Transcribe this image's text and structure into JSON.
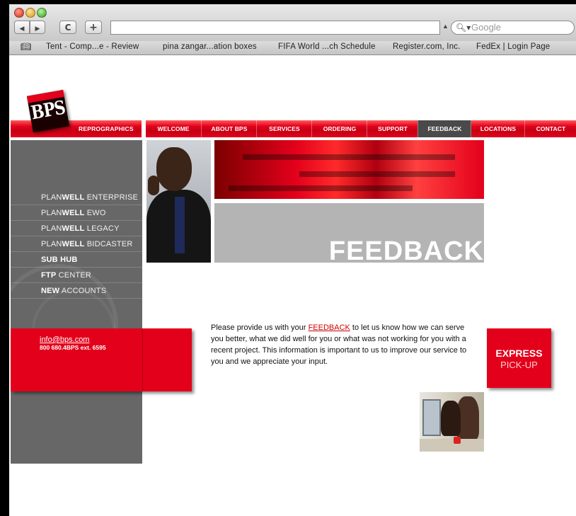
{
  "browser": {
    "back_glyph": "◀",
    "forward_glyph": "▶",
    "reload_glyph": "C",
    "add_glyph": "+",
    "url": "",
    "search_placeholder": "Google",
    "bookmarks": [
      "Tent - Comp...e - Review",
      "pina zangar...ation boxes",
      "FIFA World ...ch Schedule",
      "Register.com, Inc.",
      "FedEx | Login Page"
    ]
  },
  "site": {
    "logo_text": "BPS",
    "tagline": "REPROGRAPHICS",
    "nav": [
      "WELCOME",
      "ABOUT BPS",
      "SERVICES",
      "ORDERING",
      "SUPPORT",
      "FEEDBACK",
      "LOCATIONS",
      "CONTACT"
    ],
    "active_nav": "FEEDBACK",
    "sidebar": [
      {
        "prefix": "PLAN",
        "bold": "WELL",
        "suffix": " ENTERPRISE"
      },
      {
        "prefix": "PLAN",
        "bold": "WELL",
        "suffix": " EWO"
      },
      {
        "prefix": "PLAN",
        "bold": "WELL",
        "suffix": " LEGACY"
      },
      {
        "prefix": "PLAN",
        "bold": "WELL",
        "suffix": " BIDCASTER"
      },
      {
        "prefix": "",
        "bold": "SUB HUB",
        "suffix": ""
      },
      {
        "prefix": "",
        "bold": "FTP",
        "suffix": " CENTER"
      },
      {
        "prefix": "",
        "bold": "NEW",
        "suffix": " ACCOUNTS"
      }
    ],
    "contact": {
      "email": "info@bps.com",
      "phone": "800 680.4BPS ext. 6595"
    },
    "page_heading": "FEEDBACK",
    "intro_before": "Please provide us with your ",
    "intro_link": "FEEDBACK",
    "intro_after": " to let us know how we can serve you better, what we did well for you or what was not working for you with a recent project. This information is important to us to improve our service to you and we appreciate your input.",
    "express": {
      "line1": "EXPRESS",
      "line2": "PICK-UP"
    }
  },
  "colors": {
    "brand_red": "#e3001b",
    "sidebar_gray": "#676767",
    "active_tab": "#4a4a4a"
  }
}
